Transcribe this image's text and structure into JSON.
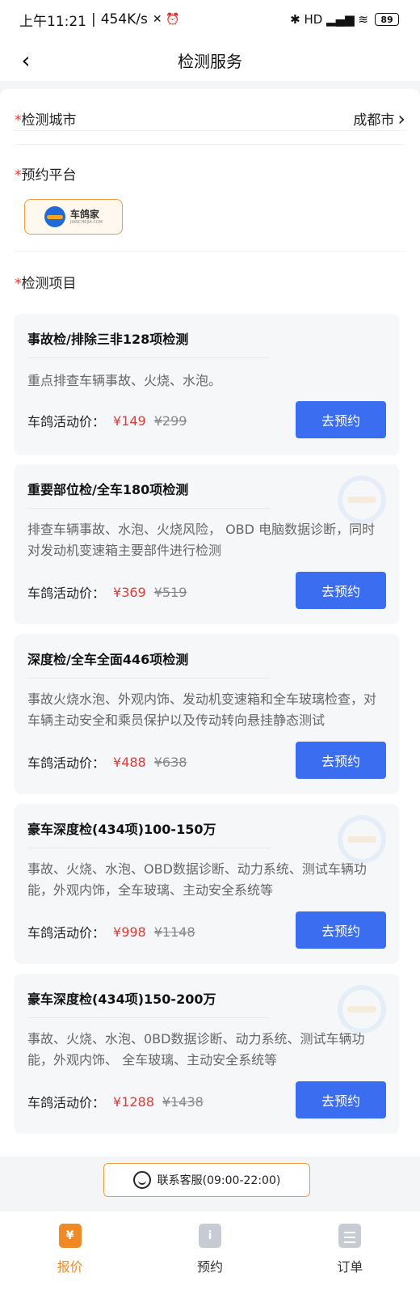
{
  "status_bar": {
    "time": "上午11:21",
    "speed": "454K/s",
    "extra_icons": "✕ ⏰",
    "right_icons": "✱ HD ▂▄▆ ≋",
    "battery": "89"
  },
  "nav": {
    "back_icon": "‹",
    "title": "检测服务"
  },
  "form": {
    "required_mark": "*",
    "city_label": "检测城市",
    "city_value": "成都市",
    "city_chevron": "›",
    "platform_label": "预约平台",
    "platform_name": "车鸽家",
    "platform_sub": "JIANCHEJIA.COM",
    "items_label": "检测项目"
  },
  "items": [
    {
      "title": "事故检/排除三非128项检测",
      "desc": "重点排查车辆事故、火烧、水泡。",
      "price_label": "车鸽活动价：",
      "price_now": "¥149",
      "price_old": "¥299",
      "button": "去预约"
    },
    {
      "title": "重要部位检/全车180项检测",
      "desc": "排查车辆事故、水泡、火烧风险， OBD 电脑数据诊断，同时对发动机变速箱主要部件进行检测",
      "price_label": "车鸽活动价：",
      "price_now": "¥369",
      "price_old": "¥519",
      "button": "去预约"
    },
    {
      "title": "深度检/全车全面446项检测",
      "desc": "事故火烧水泡、外观内饰、发动机变速箱和全车玻璃检查，对车辆主动安全和乘员保护以及传动转向悬挂静态测试",
      "price_label": "车鸽活动价：",
      "price_now": "¥488",
      "price_old": "¥638",
      "button": "去预约"
    },
    {
      "title": "豪车深度检(434项)100-150万",
      "desc": "事故、火烧、水泡、OBD数据诊断、动力系统、测试车辆功能，外观内饰，全车玻璃、主动安全系统等",
      "price_label": "车鸽活动价：",
      "price_now": "¥998",
      "price_old": "¥1148",
      "button": "去预约"
    },
    {
      "title": "豪车深度检(434项)150-200万",
      "desc": "事故、火烧、水泡、0BD数据诊断、动力系统、测试车辆功能，外观内饰、 全车玻璃、主动安全系统等",
      "price_label": "车鸽活动价：",
      "price_now": "¥1288",
      "price_old": "¥1438",
      "button": "去预约"
    }
  ],
  "service": {
    "label": "联系客服(09:00-22:00)"
  },
  "tabs": [
    {
      "label": "报价",
      "icon": "quote-icon",
      "glyph": "¥"
    },
    {
      "label": "预约",
      "icon": "booking-icon",
      "glyph": "i"
    },
    {
      "label": "订单",
      "icon": "order-icon",
      "glyph": ""
    }
  ]
}
